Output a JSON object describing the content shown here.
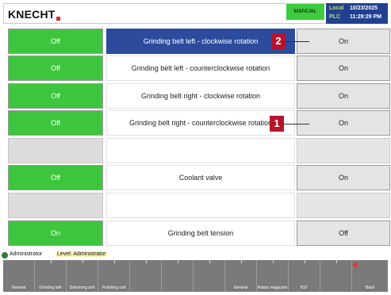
{
  "header": {
    "logo": "KNECHT",
    "mode": "MANUAL",
    "location_label": "Local",
    "plc_label": "PLC",
    "date": "10/23/2025",
    "time": "11:29:29 PM",
    "accent_color": "#e3262a"
  },
  "rows": [
    {
      "left": "Off",
      "label": "Grinding belt left - clockwise rotation",
      "right": "On",
      "selected": true
    },
    {
      "left": "Off",
      "label": "Grinding belt left - counterclockwise rotation",
      "right": "On"
    },
    {
      "left": "Off",
      "label": "Grinding belt right - clockwise rotation",
      "right": "On"
    },
    {
      "left": "Off",
      "label": "Grinding belt right - counterclockwise rotation",
      "right": "On"
    },
    {
      "left": "",
      "label": "",
      "right": ""
    },
    {
      "left": "Off",
      "label": "Coolant valve",
      "right": "On"
    },
    {
      "left": "",
      "label": "",
      "right": ""
    },
    {
      "left": "On",
      "label": "Grinding belt tension",
      "right": "Off"
    }
  ],
  "callouts": [
    "2",
    "1"
  ],
  "status": {
    "user": "Administrator",
    "level": "Level: Administrator"
  },
  "nav": [
    {
      "label": "General"
    },
    {
      "label": "Grinding belt"
    },
    {
      "label": "Deburring unit"
    },
    {
      "label": "Polishing unit"
    },
    {
      "label": ""
    },
    {
      "label": ""
    },
    {
      "label": ""
    },
    {
      "label": "General"
    },
    {
      "label": "Rotary magazine"
    },
    {
      "label": "KST"
    },
    {
      "label": ""
    },
    {
      "label": "Back"
    }
  ],
  "colors": {
    "green": "#3dc63d",
    "selected_blue": "#2c4b9c",
    "callout_red": "#b5142b"
  }
}
